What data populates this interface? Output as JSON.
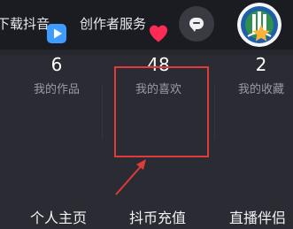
{
  "header": {
    "download_label": "下载抖音",
    "creator_label": "创作者服务",
    "message_icon": "message-bubble-icon",
    "avatar_icon": "user-avatar"
  },
  "stats": [
    {
      "icon": "play-icon",
      "count": "6",
      "label": "我的作品",
      "color": "#3f9bff"
    },
    {
      "icon": "heart-icon",
      "count": "48",
      "label": "我的喜欢",
      "color": "#fe2c55"
    },
    {
      "icon": "star-icon",
      "count": "2",
      "label": "我的收藏",
      "color": "#ffb13b"
    }
  ],
  "annotation": {
    "highlight_color": "#e03a3a"
  },
  "bottom_tabs": [
    {
      "label": "个人主页"
    },
    {
      "label": "抖币充值"
    },
    {
      "label": "直播伴侣"
    }
  ]
}
